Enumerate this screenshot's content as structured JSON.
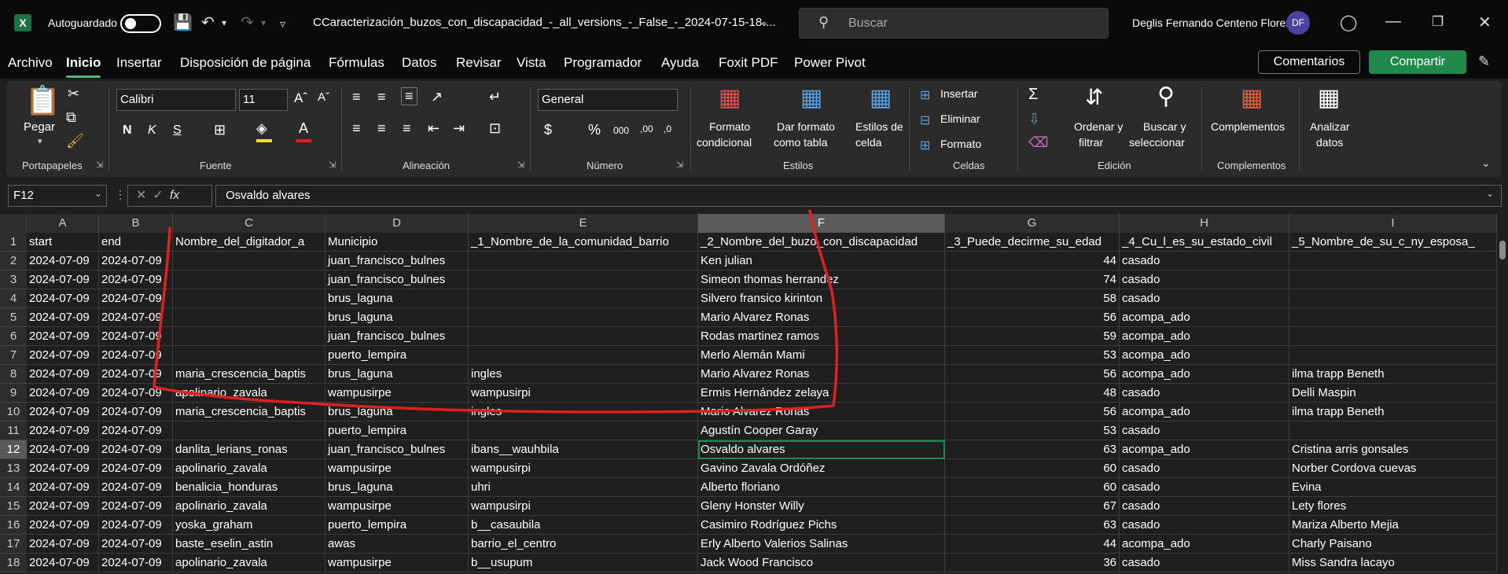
{
  "titlebar": {
    "autosave_label": "Autoguardado",
    "file_name": "CCaracterización_buzos_con_discapacidad_-_all_versions_-_False_-_2024-07-15-18-...",
    "search_placeholder": "Buscar",
    "user_name": "Deglis Fernando Centeno Flores",
    "avatar_initials": "DF"
  },
  "menu": {
    "tabs": [
      "Archivo",
      "Inicio",
      "Insertar",
      "Disposición de página",
      "Fórmulas",
      "Datos",
      "Revisar",
      "Vista",
      "Programador",
      "Ayuda",
      "Foxit PDF",
      "Power Pivot"
    ],
    "comments_label": "Comentarios",
    "share_label": "Compartir"
  },
  "ribbon": {
    "paste_label": "Pegar",
    "font_name": "Calibri",
    "font_size": "11",
    "number_format": "General",
    "format_conditional": [
      "Formato",
      "condicional"
    ],
    "format_table": [
      "Dar formato",
      "como tabla"
    ],
    "cell_styles": [
      "Estilos de",
      "celda"
    ],
    "insert_label": "Insertar",
    "delete_label": "Eliminar",
    "format_label": "Formato",
    "sort_filter": [
      "Ordenar y",
      "filtrar"
    ],
    "find_select": [
      "Buscar y",
      "seleccionar"
    ],
    "addins_label": "Complementos",
    "analyze": [
      "Analizar",
      "datos"
    ],
    "groups": {
      "clipboard": "Portapapeles",
      "font": "Fuente",
      "alignment": "Alineación",
      "number": "Número",
      "styles": "Estilos",
      "cells": "Celdas",
      "editing": "Edición",
      "addins": "Complementos"
    }
  },
  "formula_bar": {
    "name_box": "F12",
    "formula": "Osvaldo alvares"
  },
  "sheet": {
    "columns": [
      "A",
      "B",
      "C",
      "D",
      "E",
      "F",
      "G",
      "H",
      "I"
    ],
    "row_numbers": [
      "1",
      "2",
      "3",
      "4",
      "5",
      "6",
      "7",
      "8",
      "9",
      "10",
      "11",
      "12",
      "13",
      "14",
      "15",
      "16",
      "17",
      "18"
    ],
    "rows": [
      [
        "start",
        "end",
        "Nombre_del_digitador_a",
        "Municipio",
        "_1_Nombre_de_la_comunidad_barrio",
        "_2_Nombre_del_buzo_con_discapacidad",
        "_3_Puede_decirme_su_edad",
        "_4_Cu_l_es_su_estado_civil",
        "_5_Nombre_de_su_c_ny_esposa_"
      ],
      [
        "2024-07-09",
        "2024-07-09",
        "",
        "juan_francisco_bulnes",
        "",
        "Ken julian",
        "44",
        "casado",
        ""
      ],
      [
        "2024-07-09",
        "2024-07-09",
        "",
        "juan_francisco_bulnes",
        "",
        "Simeon thomas herrandez",
        "74",
        "casado",
        ""
      ],
      [
        "2024-07-09",
        "2024-07-09",
        "",
        "brus_laguna",
        "",
        "Silvero fransico kirinton",
        "58",
        "casado",
        ""
      ],
      [
        "2024-07-09",
        "2024-07-09",
        "",
        "brus_laguna",
        "",
        "Mario Alvarez Ronas",
        "56",
        "acompa_ado",
        ""
      ],
      [
        "2024-07-09",
        "2024-07-09",
        "",
        "juan_francisco_bulnes",
        "",
        "Rodas martinez ramos",
        "59",
        "acompa_ado",
        ""
      ],
      [
        "2024-07-09",
        "2024-07-09",
        "",
        "puerto_lempira",
        "",
        "Merlo Alemán Mami",
        "53",
        "acompa_ado",
        ""
      ],
      [
        "2024-07-09",
        "2024-07-09",
        "maria_crescencia_baptis",
        "brus_laguna",
        "ingles",
        "Mario Alvarez Ronas",
        "56",
        "acompa_ado",
        "ilma trapp Beneth"
      ],
      [
        "2024-07-09",
        "2024-07-09",
        "apolinario_zavala",
        "wampusirpe",
        "wampusirpi",
        "Ermis Hernández zelaya",
        "48",
        "casado",
        "Delli Maspin"
      ],
      [
        "2024-07-09",
        "2024-07-09",
        "maria_crescencia_baptis",
        "brus_laguna",
        "ingles",
        "Mario Alvarez Ronas",
        "56",
        "acompa_ado",
        "ilma trapp Beneth"
      ],
      [
        "2024-07-09",
        "2024-07-09",
        "",
        "puerto_lempira",
        "",
        "Agustín Cooper Garay",
        "53",
        "casado",
        ""
      ],
      [
        "2024-07-09",
        "2024-07-09",
        "danlita_lerians_ronas",
        "juan_francisco_bulnes",
        "ibans__wauhbila",
        "Osvaldo alvares",
        "63",
        "acompa_ado",
        "Cristina arris gonsales"
      ],
      [
        "2024-07-09",
        "2024-07-09",
        "apolinario_zavala",
        "wampusirpe",
        "wampusirpi",
        "Gavino Zavala Ordóñez",
        "60",
        "casado",
        "Norber Cordova cuevas"
      ],
      [
        "2024-07-09",
        "2024-07-09",
        "benalicia_honduras",
        "brus_laguna",
        "uhri",
        "Alberto floriano",
        "60",
        "casado",
        "Evina"
      ],
      [
        "2024-07-09",
        "2024-07-09",
        "apolinario_zavala",
        "wampusirpe",
        "wampusirpi",
        "Gleny Honster Willy",
        "67",
        "casado",
        "Lety flores"
      ],
      [
        "2024-07-09",
        "2024-07-09",
        "yoska_graham",
        "puerto_lempira",
        "b__casaubila",
        "Casimiro  Rodríguez Pichs",
        "63",
        "casado",
        "Mariza Alberto Mejia"
      ],
      [
        "2024-07-09",
        "2024-07-09",
        "baste_eselin_astin",
        "awas",
        "barrio_el_centro",
        "Erly Alberto Valerios Salinas",
        "44",
        "acompa_ado",
        "Charly Paisano"
      ],
      [
        "2024-07-09",
        "2024-07-09",
        "apolinario_zavala",
        "wampusirpe",
        "b__usupum",
        "Jack Wood Francisco",
        "36",
        "casado",
        "Miss Sandra lacayo"
      ]
    ]
  },
  "colors": {
    "accent_green": "#1f8a4c",
    "annotation_red": "#e02020"
  }
}
